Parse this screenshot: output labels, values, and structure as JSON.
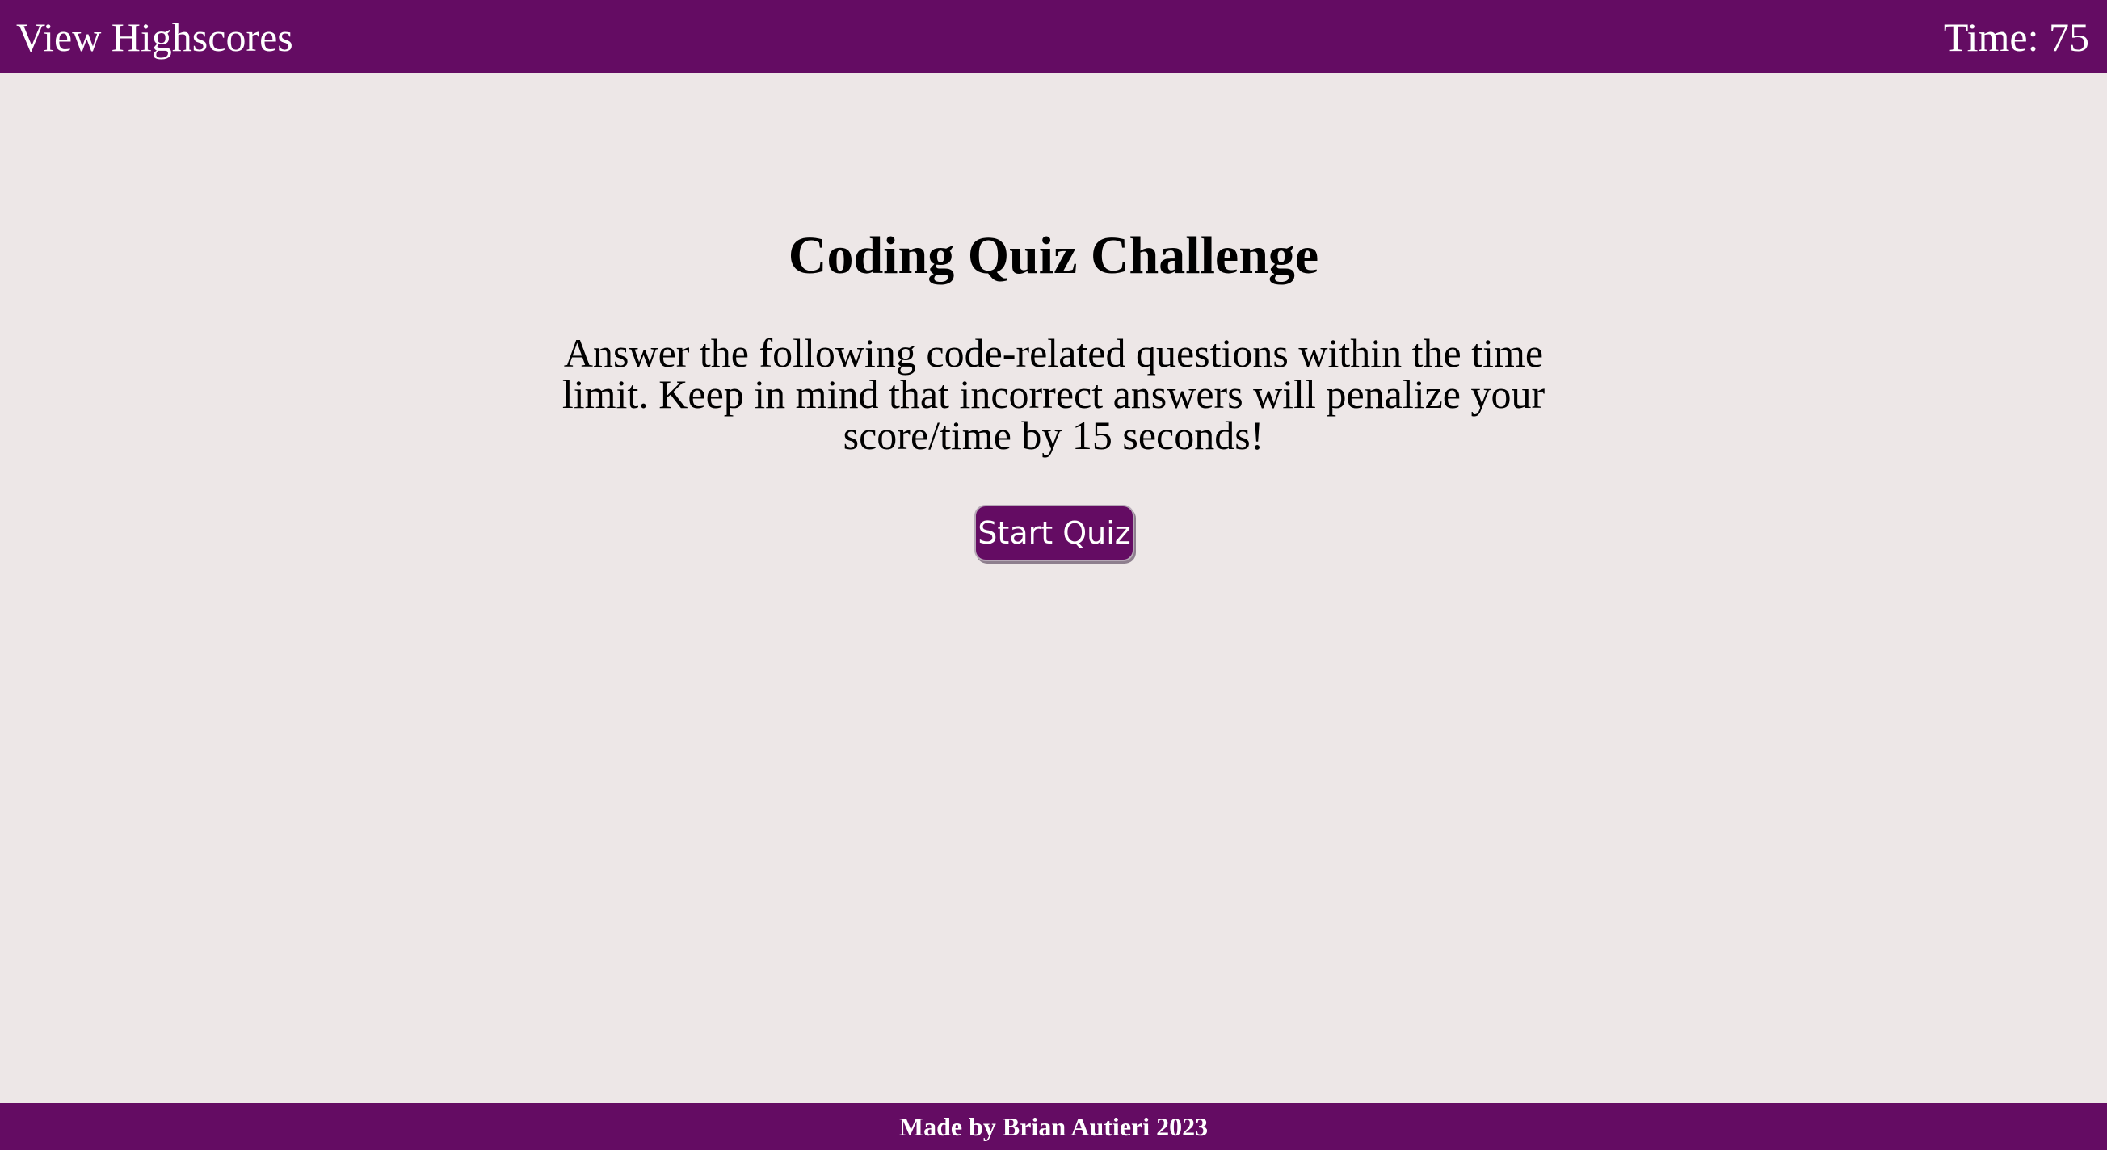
{
  "header": {
    "highscores_label": "View Highscores",
    "timer_label": "Time: 75"
  },
  "main": {
    "title": "Coding Quiz Challenge",
    "description": "Answer the following code-related questions within the time limit. Keep in mind that incorrect answers will penalize your score/time by 15 seconds!",
    "start_button_label": "Start Quiz"
  },
  "footer": {
    "credit": "Made by Brian Autieri 2023"
  },
  "colors": {
    "brand": "#640c63",
    "background": "#ede7e7",
    "text_light": "#ffffff",
    "text_dark": "#000000"
  }
}
